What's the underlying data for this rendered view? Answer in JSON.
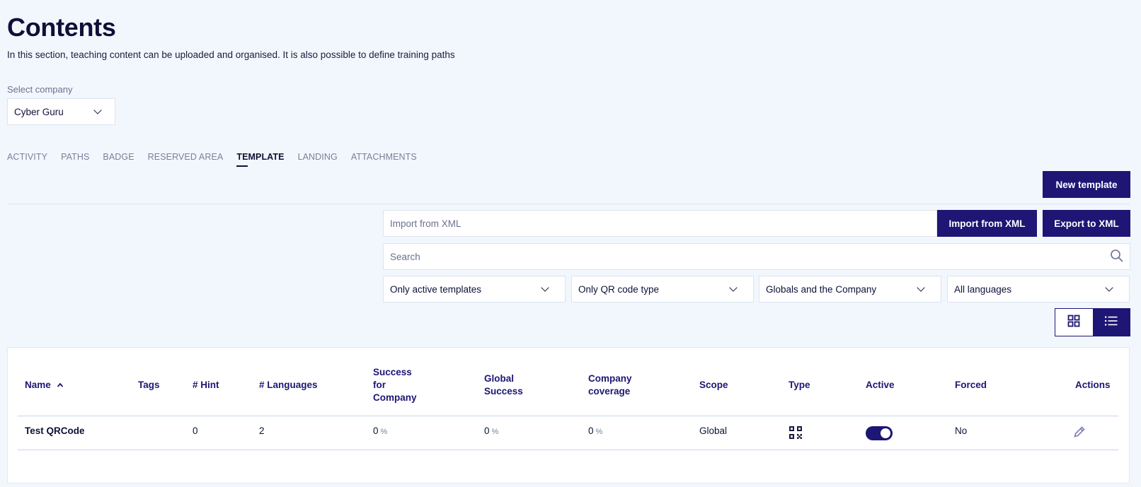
{
  "page": {
    "title": "Contents",
    "subtitle": "In this section, teaching content can be uploaded and organised. It is also possible to define training paths"
  },
  "company": {
    "label": "Select company",
    "value": "Cyber Guru"
  },
  "tabs": [
    {
      "label": "ACTIVITY"
    },
    {
      "label": "PATHS"
    },
    {
      "label": "BADGE"
    },
    {
      "label": "RESERVED AREA"
    },
    {
      "label": "TEMPLATE"
    },
    {
      "label": "LANDING"
    },
    {
      "label": "ATTACHMENTS"
    }
  ],
  "toolbar": {
    "new_template": "New template",
    "import_placeholder": "Import from XML",
    "import_button": "Import from XML",
    "export_button": "Export to XML",
    "search_placeholder": "Search"
  },
  "filters": [
    {
      "value": "Only active templates"
    },
    {
      "value": "Only QR code type"
    },
    {
      "value": "Globals and the Company"
    },
    {
      "value": "All languages"
    }
  ],
  "table": {
    "headers": {
      "name": "Name",
      "tags": "Tags",
      "hint": "# Hint",
      "languages": "# Languages",
      "success_company_1": "Success",
      "success_company_2": "for",
      "success_company_3": "Company",
      "global_success_1": "Global",
      "global_success_2": "Success",
      "company_coverage_1": "Company",
      "company_coverage_2": "coverage",
      "scope": "Scope",
      "type": "Type",
      "active": "Active",
      "forced": "Forced",
      "actions": "Actions"
    },
    "rows": [
      {
        "name": "Test QRCode",
        "tags": "",
        "hint": "0",
        "languages": "2",
        "success_company": "0",
        "global_success": "0",
        "company_coverage": "0",
        "pct_symbol": "%",
        "scope": "Global",
        "type_icon": "qr-code-icon",
        "active": true,
        "forced": "No"
      }
    ]
  },
  "colors": {
    "primary": "#1d1674",
    "background": "#f2f7fd",
    "text": "#0f1037"
  }
}
